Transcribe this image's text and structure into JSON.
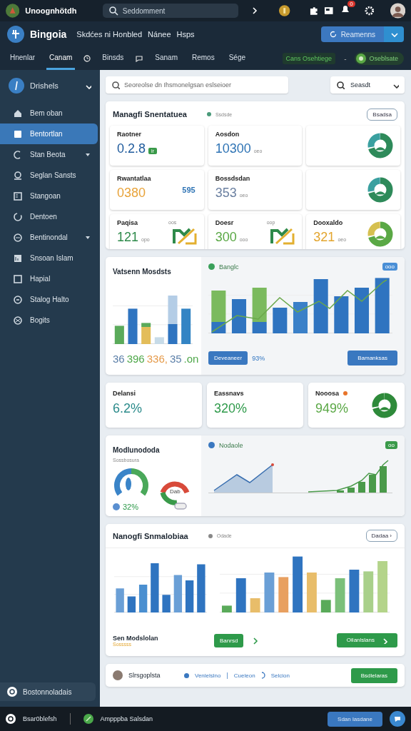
{
  "top_bar": {
    "app_name": "Unoognhötdh",
    "search": {
      "placeholder": "Seddomment"
    },
    "notification_count": "0"
  },
  "header": {
    "title": "Bingoia",
    "links": [
      "Skdćes ni Honbled",
      "Nánee",
      "Hsps"
    ],
    "action_button": "Reamenns"
  },
  "tabs": [
    {
      "label": "Hnenlar",
      "selected": false
    },
    {
      "label": "Canam",
      "selected": true
    },
    {
      "label": "Binsds",
      "selected": false
    },
    {
      "label": "Sanam",
      "selected": false
    },
    {
      "label": "Remos",
      "selected": false
    },
    {
      "label": "Sége",
      "selected": false
    }
  ],
  "status": {
    "label": "Cans Osehtiege",
    "separator": "-",
    "badge": "Oseblsate"
  },
  "sidebar": {
    "header": "Drishels",
    "items": [
      {
        "label": "Bem oban",
        "selected": false,
        "expandable": false
      },
      {
        "label": "Bentortlan",
        "selected": true,
        "expandable": false
      },
      {
        "label": "Stan Beota",
        "selected": false,
        "expandable": true
      },
      {
        "label": "Seglan Sansts",
        "selected": false,
        "expandable": false
      },
      {
        "label": "Stangoan",
        "selected": false,
        "expandable": false
      },
      {
        "label": "Dentoen",
        "selected": false,
        "expandable": false
      },
      {
        "label": "Bentinondal",
        "selected": false,
        "expandable": true
      },
      {
        "label": "Snsoan Islam",
        "selected": false,
        "expandable": false
      },
      {
        "label": "Hapial",
        "selected": false,
        "expandable": false
      },
      {
        "label": "Stalog Halto",
        "selected": false,
        "expandable": false
      },
      {
        "label": "Bogits",
        "selected": false,
        "expandable": false
      }
    ],
    "footer": "Bostonnoladais"
  },
  "search": {
    "placeholder": "Seoreolse dn Ihsmonelgsan eslseioer"
  },
  "filter": {
    "label": "Seasdt"
  },
  "summary": {
    "title": "Managfi Snentatuea",
    "legend": "Ssdsde",
    "button": "Bsadsa",
    "tiles": [
      {
        "kind": "stat",
        "label": "Raotner",
        "value": "0.2.8",
        "tag": "ir",
        "color": "#1e5a9c"
      },
      {
        "kind": "stat",
        "label": "Aosdon",
        "value": "10300",
        "unit": "oeo",
        "color": "#2f74b5"
      },
      {
        "kind": "donut"
      },
      {
        "kind": "stat",
        "label": "Rwantatlaa",
        "value": "0380",
        "note": "595",
        "color": "#e8a33a"
      },
      {
        "kind": "stat",
        "label": "Bossdsdan",
        "value": "353",
        "unit": "oeo",
        "color": "#6a7fa0"
      },
      {
        "kind": "donut"
      },
      {
        "kind": "trend",
        "label": "Paqisa",
        "value": "121",
        "unit": "opo",
        "note": "oos",
        "color": "#2e8a4a"
      },
      {
        "kind": "trend",
        "label": "Doesr",
        "value": "300",
        "unit": "ooo",
        "note": "oop",
        "color": "#5aa845"
      },
      {
        "kind": "stat_donut",
        "label": "Dooxaldo",
        "value": "321",
        "unit": "oeo",
        "color": "#e3a52e"
      }
    ]
  },
  "performance": {
    "title": "Vatsenn Mosdsts",
    "figures": [
      {
        "text": "36",
        "color": "#5b7fa8"
      },
      {
        "text": "396",
        "color": "#4fa84a"
      },
      {
        "text": "336,",
        "color": "#e59a4a"
      },
      {
        "text": "35",
        "color": "#5b7fa8"
      },
      {
        "text": ".on",
        "color": "#4fa84a"
      }
    ],
    "legend": "Banglc",
    "badge": "ooo",
    "button": "Deveaneer",
    "percent": "93%",
    "action": "Bamanksas"
  },
  "stats": [
    {
      "kind": "plain",
      "label": "Delansi",
      "value": "6.2%",
      "color": "#2a8a8a",
      "alert": false
    },
    {
      "kind": "plain",
      "label": "Eassnavs",
      "value": "320%",
      "color": "#2e9a4a",
      "alert": false
    },
    {
      "kind": "donut",
      "label": "Nooosa",
      "value": "949%",
      "color": "#5aa845",
      "alert": true
    }
  ],
  "gauges": {
    "title": "Modlunododa",
    "subtitle": "Sossbosura",
    "percent": "32%",
    "gauge_label": "Dab",
    "legend": "Nodaole",
    "badge": "oo"
  },
  "comparison": {
    "title": "Nanogfi Snmalobiaa",
    "legend": "Odade",
    "button": "Dadaa ›",
    "footer_title": "Sen Modslolan",
    "footer_note": "Sosssss",
    "small_button": "Banrsd",
    "action": "Oilanlslans"
  },
  "profile": {
    "name": "Slrsgoplsta",
    "status": "Venlelslno",
    "separator": "|",
    "link": "Cueleon",
    "link_2": "Selcion",
    "button": "Bsdlelaras"
  },
  "bottom_bar": {
    "left": "Bsar0blefsh",
    "app": "Ampppba Salsdan",
    "button": "Sdan lasdane"
  }
}
